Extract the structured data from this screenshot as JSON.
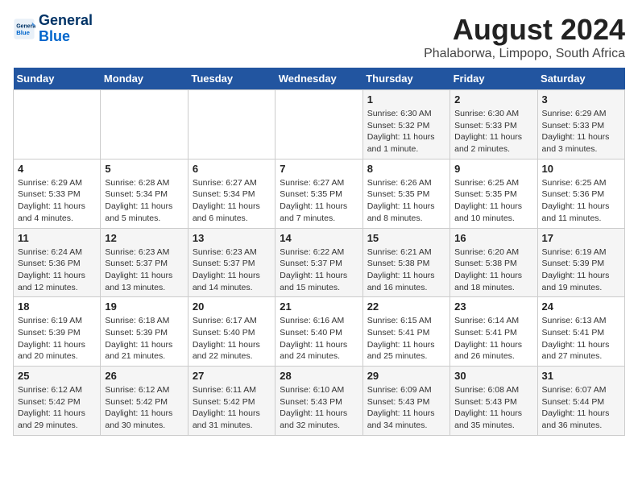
{
  "logo": {
    "line1": "General",
    "line2": "Blue"
  },
  "title": "August 2024",
  "subtitle": "Phalaborwa, Limpopo, South Africa",
  "days_of_week": [
    "Sunday",
    "Monday",
    "Tuesday",
    "Wednesday",
    "Thursday",
    "Friday",
    "Saturday"
  ],
  "weeks": [
    [
      {
        "day": "",
        "info": ""
      },
      {
        "day": "",
        "info": ""
      },
      {
        "day": "",
        "info": ""
      },
      {
        "day": "",
        "info": ""
      },
      {
        "day": "1",
        "info": "Sunrise: 6:30 AM\nSunset: 5:32 PM\nDaylight: 11 hours\nand 1 minute."
      },
      {
        "day": "2",
        "info": "Sunrise: 6:30 AM\nSunset: 5:33 PM\nDaylight: 11 hours\nand 2 minutes."
      },
      {
        "day": "3",
        "info": "Sunrise: 6:29 AM\nSunset: 5:33 PM\nDaylight: 11 hours\nand 3 minutes."
      }
    ],
    [
      {
        "day": "4",
        "info": "Sunrise: 6:29 AM\nSunset: 5:33 PM\nDaylight: 11 hours\nand 4 minutes."
      },
      {
        "day": "5",
        "info": "Sunrise: 6:28 AM\nSunset: 5:34 PM\nDaylight: 11 hours\nand 5 minutes."
      },
      {
        "day": "6",
        "info": "Sunrise: 6:27 AM\nSunset: 5:34 PM\nDaylight: 11 hours\nand 6 minutes."
      },
      {
        "day": "7",
        "info": "Sunrise: 6:27 AM\nSunset: 5:35 PM\nDaylight: 11 hours\nand 7 minutes."
      },
      {
        "day": "8",
        "info": "Sunrise: 6:26 AM\nSunset: 5:35 PM\nDaylight: 11 hours\nand 8 minutes."
      },
      {
        "day": "9",
        "info": "Sunrise: 6:25 AM\nSunset: 5:35 PM\nDaylight: 11 hours\nand 10 minutes."
      },
      {
        "day": "10",
        "info": "Sunrise: 6:25 AM\nSunset: 5:36 PM\nDaylight: 11 hours\nand 11 minutes."
      }
    ],
    [
      {
        "day": "11",
        "info": "Sunrise: 6:24 AM\nSunset: 5:36 PM\nDaylight: 11 hours\nand 12 minutes."
      },
      {
        "day": "12",
        "info": "Sunrise: 6:23 AM\nSunset: 5:37 PM\nDaylight: 11 hours\nand 13 minutes."
      },
      {
        "day": "13",
        "info": "Sunrise: 6:23 AM\nSunset: 5:37 PM\nDaylight: 11 hours\nand 14 minutes."
      },
      {
        "day": "14",
        "info": "Sunrise: 6:22 AM\nSunset: 5:37 PM\nDaylight: 11 hours\nand 15 minutes."
      },
      {
        "day": "15",
        "info": "Sunrise: 6:21 AM\nSunset: 5:38 PM\nDaylight: 11 hours\nand 16 minutes."
      },
      {
        "day": "16",
        "info": "Sunrise: 6:20 AM\nSunset: 5:38 PM\nDaylight: 11 hours\nand 18 minutes."
      },
      {
        "day": "17",
        "info": "Sunrise: 6:19 AM\nSunset: 5:39 PM\nDaylight: 11 hours\nand 19 minutes."
      }
    ],
    [
      {
        "day": "18",
        "info": "Sunrise: 6:19 AM\nSunset: 5:39 PM\nDaylight: 11 hours\nand 20 minutes."
      },
      {
        "day": "19",
        "info": "Sunrise: 6:18 AM\nSunset: 5:39 PM\nDaylight: 11 hours\nand 21 minutes."
      },
      {
        "day": "20",
        "info": "Sunrise: 6:17 AM\nSunset: 5:40 PM\nDaylight: 11 hours\nand 22 minutes."
      },
      {
        "day": "21",
        "info": "Sunrise: 6:16 AM\nSunset: 5:40 PM\nDaylight: 11 hours\nand 24 minutes."
      },
      {
        "day": "22",
        "info": "Sunrise: 6:15 AM\nSunset: 5:41 PM\nDaylight: 11 hours\nand 25 minutes."
      },
      {
        "day": "23",
        "info": "Sunrise: 6:14 AM\nSunset: 5:41 PM\nDaylight: 11 hours\nand 26 minutes."
      },
      {
        "day": "24",
        "info": "Sunrise: 6:13 AM\nSunset: 5:41 PM\nDaylight: 11 hours\nand 27 minutes."
      }
    ],
    [
      {
        "day": "25",
        "info": "Sunrise: 6:12 AM\nSunset: 5:42 PM\nDaylight: 11 hours\nand 29 minutes."
      },
      {
        "day": "26",
        "info": "Sunrise: 6:12 AM\nSunset: 5:42 PM\nDaylight: 11 hours\nand 30 minutes."
      },
      {
        "day": "27",
        "info": "Sunrise: 6:11 AM\nSunset: 5:42 PM\nDaylight: 11 hours\nand 31 minutes."
      },
      {
        "day": "28",
        "info": "Sunrise: 6:10 AM\nSunset: 5:43 PM\nDaylight: 11 hours\nand 32 minutes."
      },
      {
        "day": "29",
        "info": "Sunrise: 6:09 AM\nSunset: 5:43 PM\nDaylight: 11 hours\nand 34 minutes."
      },
      {
        "day": "30",
        "info": "Sunrise: 6:08 AM\nSunset: 5:43 PM\nDaylight: 11 hours\nand 35 minutes."
      },
      {
        "day": "31",
        "info": "Sunrise: 6:07 AM\nSunset: 5:44 PM\nDaylight: 11 hours\nand 36 minutes."
      }
    ]
  ]
}
